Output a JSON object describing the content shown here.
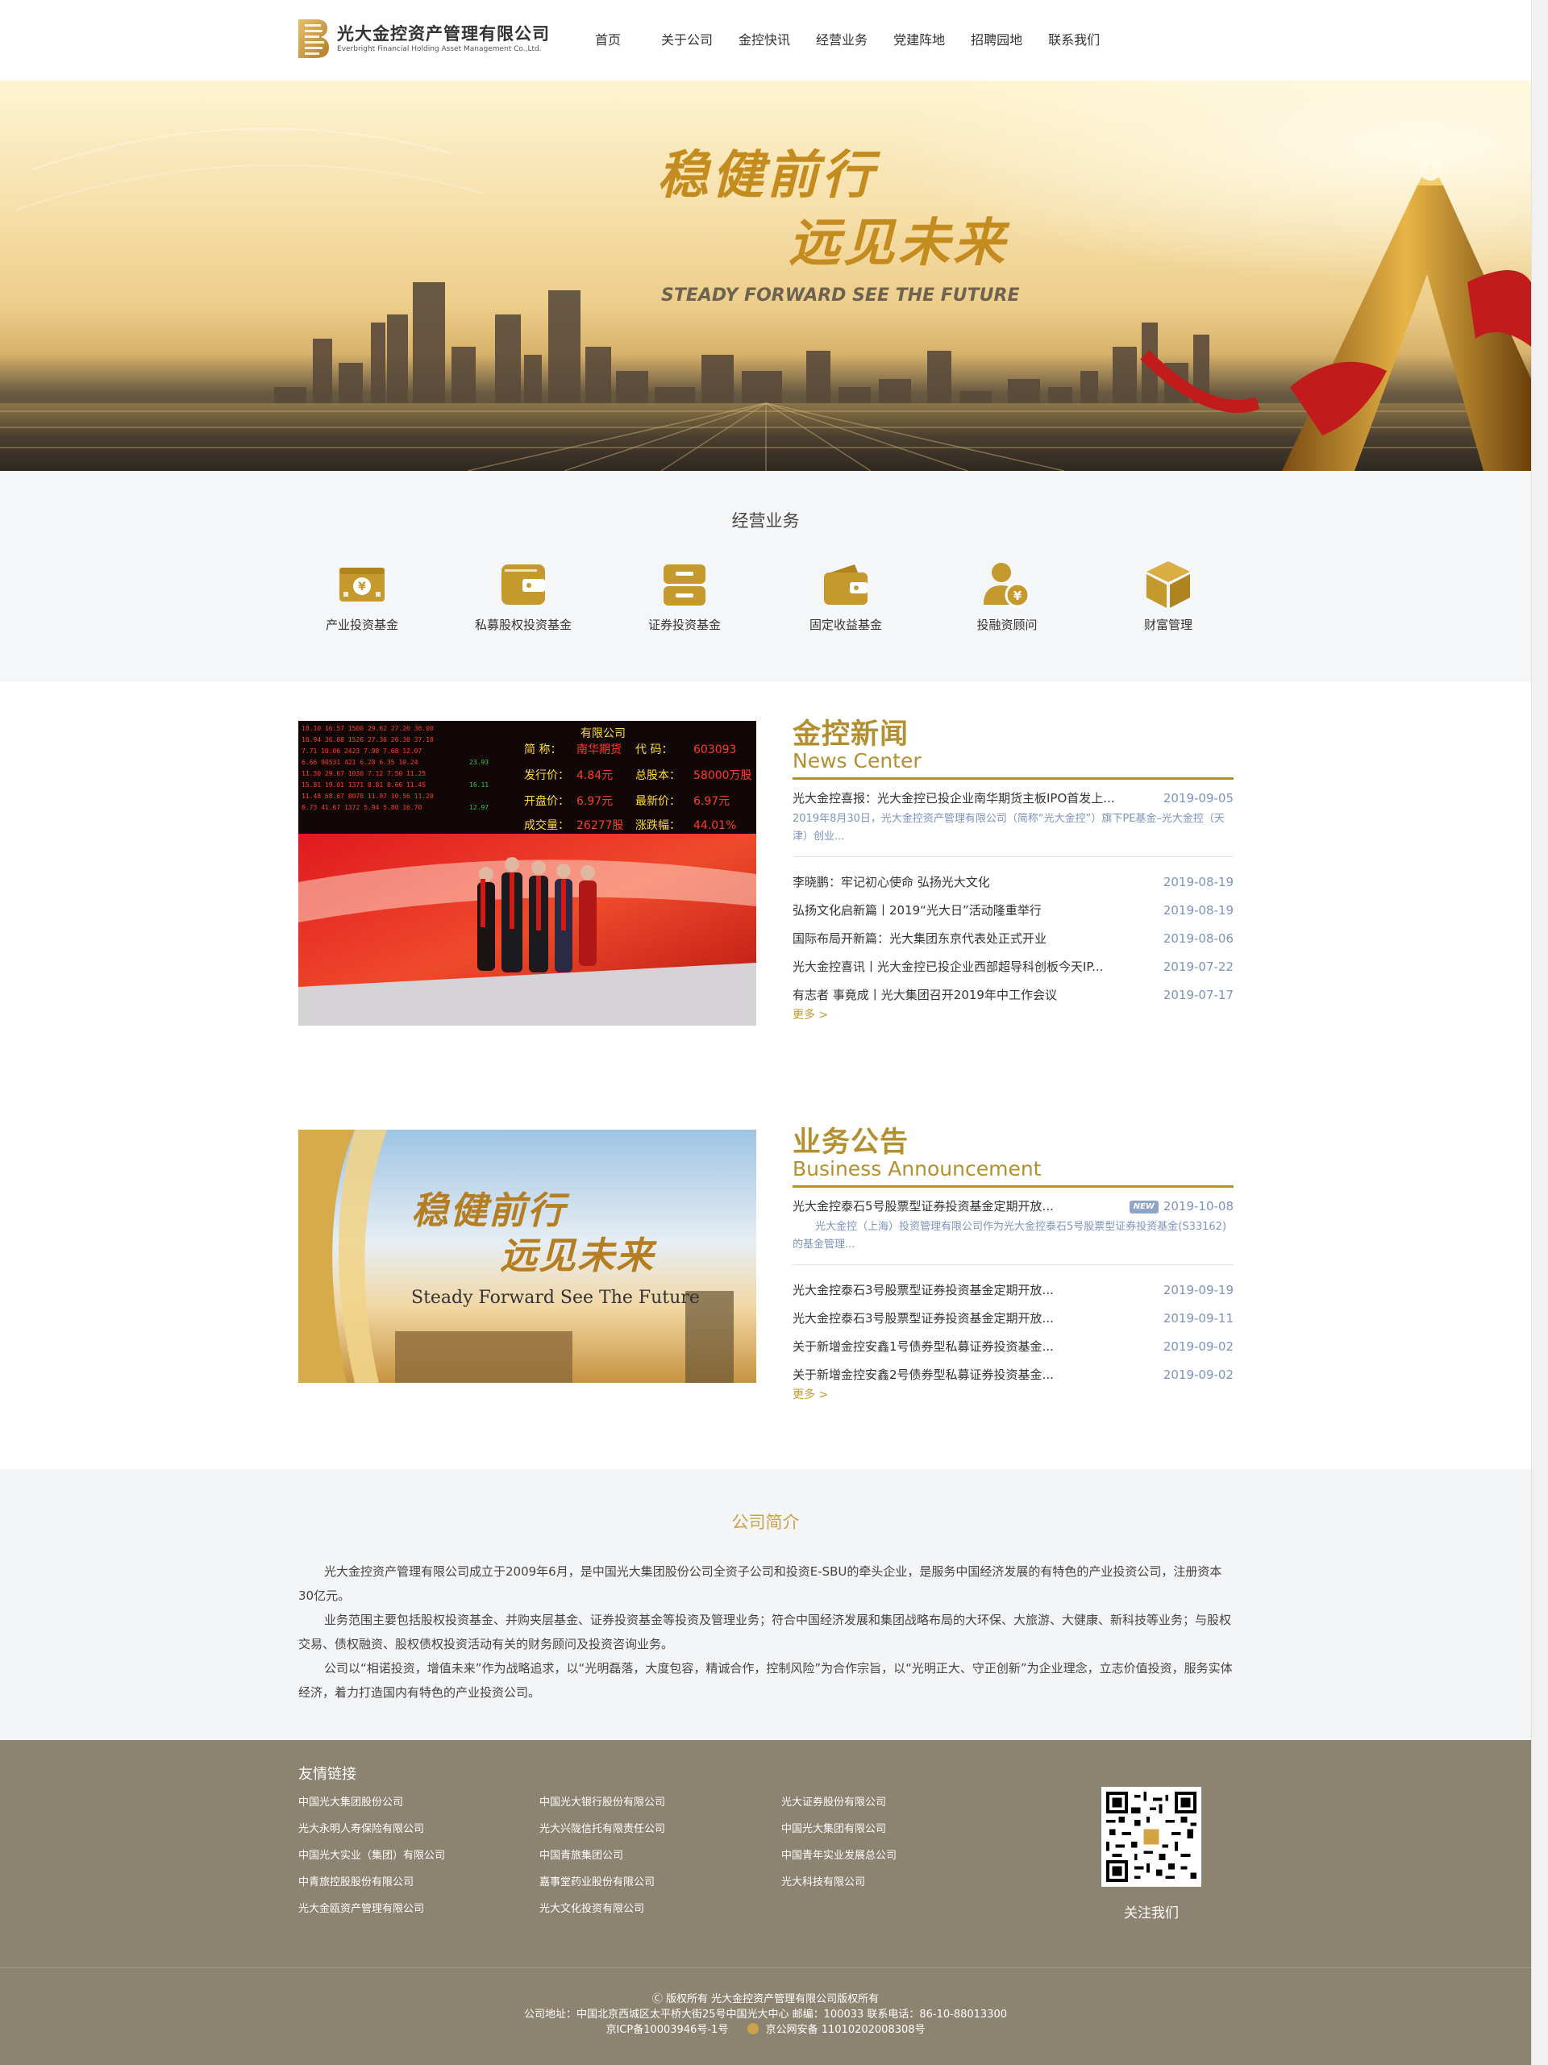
{
  "header": {
    "logo_cn": "光大金控资产管理有限公司",
    "logo_en": "Everbright Financial Holding Asset Management Co.,Ltd.",
    "nav": [
      "首页",
      "关于公司",
      "金控快讯",
      "经营业务",
      "党建阵地",
      "招聘园地",
      "联系我们"
    ]
  },
  "banner": {
    "slogan_line1": "稳健前行",
    "slogan_line2": "远见未来",
    "slogan_en": "STEADY FORWARD SEE THE FUTURE"
  },
  "business": {
    "title": "经营业务",
    "items": [
      {
        "label": "产业投资基金",
        "icon": "money-card-icon"
      },
      {
        "label": "私募股权投资基金",
        "icon": "wallet-icon"
      },
      {
        "label": "证券投资基金",
        "icon": "drawer-icon"
      },
      {
        "label": "固定收益基金",
        "icon": "purse-icon"
      },
      {
        "label": "投融资顾问",
        "icon": "advisor-icon"
      },
      {
        "label": "财富管理",
        "icon": "cube-icon"
      }
    ]
  },
  "news": {
    "title": "金控新闻",
    "subtitle": "News Center",
    "image_text": {
      "board_labels": [
        "简 称：",
        "发行价：",
        "开盘价：",
        "成交量："
      ],
      "board_values": [
        "南华期货",
        "4.84元",
        "6.97元",
        "26277股"
      ],
      "board_labels_right": [
        "代 码：",
        "总股本：",
        "最新价：",
        "涨跌幅："
      ],
      "board_values_right": [
        "603093",
        "58000万股",
        "6.97元",
        "44.01%"
      ],
      "board_header": "有限公司"
    },
    "first": {
      "title": "光大金控喜报：光大金控已投企业南华期货主板IPO首发上...",
      "date": "2019-09-05",
      "desc": "2019年8月30日，光大金控资产管理有限公司（简称“光大金控”）旗下PE基金–光大金控（天津）创业..."
    },
    "items": [
      {
        "title": "李晓鹏：牢记初心使命 弘扬光大文化",
        "date": "2019-08-19"
      },
      {
        "title": "弘扬文化启新篇丨2019“光大日”活动隆重举行",
        "date": "2019-08-19"
      },
      {
        "title": "国际布局开新篇：光大集团东京代表处正式开业",
        "date": "2019-08-06"
      },
      {
        "title": "光大金控喜讯丨光大金控已投企业西部超导科创板今天IP...",
        "date": "2019-07-22"
      },
      {
        "title": "有志者 事竟成丨光大集团召开2019年中工作会议",
        "date": "2019-07-17"
      }
    ],
    "more": "更多 >"
  },
  "announcement": {
    "title": "业务公告",
    "subtitle": "Business Announcement",
    "image_text": {
      "slogan_line1": "稳健前行",
      "slogan_line2": "远见未来",
      "slogan_en": "Steady Forward See The Future"
    },
    "first": {
      "title": "光大金控泰石5号股票型证券投资基金定期开放...",
      "badge": "NEW",
      "date": "2019-10-08",
      "desc": "光大金控（上海）投资管理有限公司作为光大金控泰石5号股票型证券投资基金(S33162)的基金管理..."
    },
    "items": [
      {
        "title": "光大金控泰石3号股票型证券投资基金定期开放...",
        "date": "2019-09-19"
      },
      {
        "title": "光大金控泰石3号股票型证券投资基金定期开放...",
        "date": "2019-09-11"
      },
      {
        "title": "关于新增金控安鑫1号债券型私募证券投资基金...",
        "date": "2019-09-02"
      },
      {
        "title": "关于新增金控安鑫2号债券型私募证券投资基金...",
        "date": "2019-09-02"
      }
    ],
    "more": "更多 >"
  },
  "intro": {
    "title": "公司简介",
    "paragraphs": [
      "光大金控资产管理有限公司成立于2009年6月，是中国光大集团股份公司全资子公司和投资E-SBU的牵头企业，是服务中国经济发展的有特色的产业投资公司，注册资本30亿元。",
      "业务范围主要包括股权投资基金、并购夹层基金、证券投资基金等投资及管理业务；符合中国经济发展和集团战略布局的大环保、大旅游、大健康、新科技等业务；与股权交易、债权融资、股权债权投资活动有关的财务顾问及投资咨询业务。",
      "公司以“相诺投资，增值未来”作为战略追求，以“光明磊落，大度包容，精诚合作，控制风险”为合作宗旨，以“光明正大、守正创新”为企业理念，立志价值投资，服务实体经济，着力打造国内有特色的产业投资公司。"
    ]
  },
  "footer": {
    "links_title": "友情链接",
    "links": [
      [
        "中国光大集团股份公司",
        "中国光大银行股份有限公司",
        "光大证券股份有限公司"
      ],
      [
        "光大永明人寿保险有限公司",
        "光大兴陇信托有限责任公司",
        "中国光大集团有限公司"
      ],
      [
        "中国光大实业（集团）有限公司",
        "中国青旅集团公司",
        "中国青年实业发展总公司"
      ],
      [
        "中青旅控股股份有限公司",
        "嘉事堂药业股份有限公司",
        "光大科技有限公司"
      ],
      [
        "光大金瓯资产管理有限公司",
        "光大文化投资有限公司"
      ]
    ],
    "qr_label": "关注我们",
    "copyright": "Ⓒ 版权所有 光大金控资产管理有限公司版权所有",
    "address": "公司地址：中国北京西城区太平桥大街25号中国光大中心 邮编：100033 联系电话：86-10-88013300",
    "icp": "京ICP备10003946号-1号",
    "police": "京公网安备 11010202008308号"
  },
  "colors": {
    "gold": "#b3902f",
    "link_gold": "#c49a2e",
    "date_blue": "#7d93bd",
    "footer_bg": "#8c8370"
  }
}
